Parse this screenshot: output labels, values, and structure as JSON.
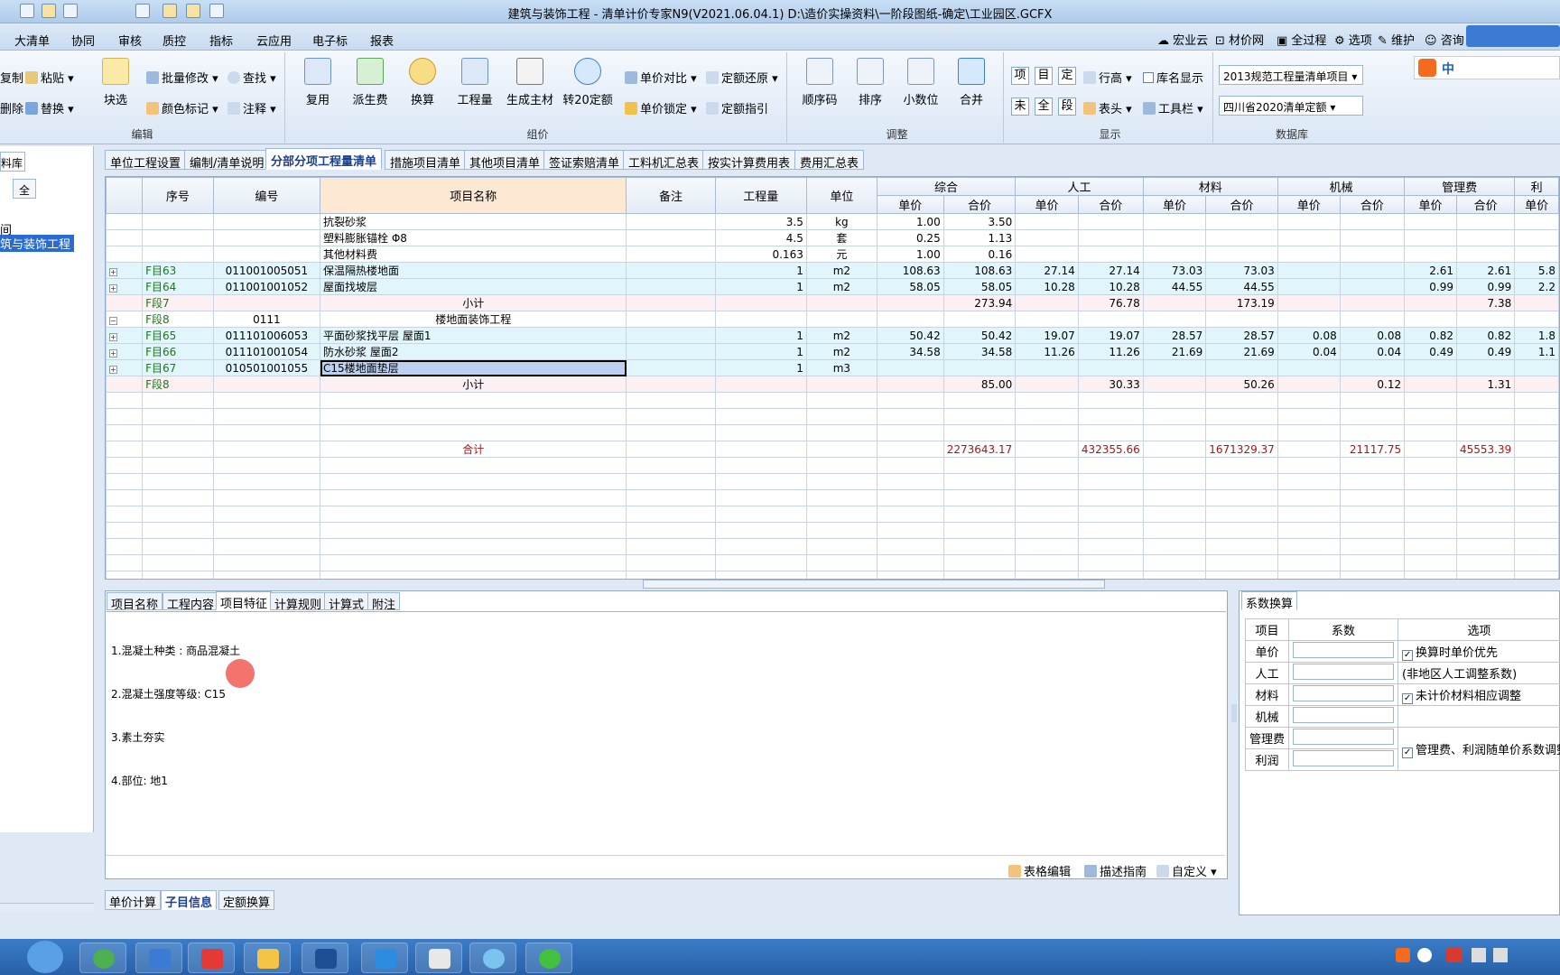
{
  "window": {
    "title": "建筑与装饰工程 - 清单计价专家N9(V2021.06.04.1) D:\\造价实操资料\\一阶段图纸-确定\\工业园区.GCFX"
  },
  "menu": {
    "items": [
      "大清单",
      "协同",
      "审核",
      "质控",
      "指标",
      "云应用",
      "电子标",
      "报表"
    ],
    "right": [
      "宏业云",
      "材价网",
      "全过程",
      "选项",
      "维护",
      "咨询"
    ]
  },
  "ribbon": {
    "edit": {
      "label": "编辑",
      "copy": "复制",
      "paste": "粘贴",
      "delete": "删除",
      "replace": "替换",
      "block_select": "块选",
      "batch_modify": "批量修改",
      "find": "查找",
      "color_mark": "颜色标记",
      "annotate": "注释"
    },
    "pricing": {
      "label": "组价",
      "reuse": "复用",
      "derive_fee": "派生费",
      "convert": "换算",
      "quantity": "工程量",
      "gen_material": "生成主材",
      "to_20_quota": "转20定额",
      "price_compare": "单价对比",
      "quota_restore": "定额还原",
      "price_lock": "单价锁定",
      "quota_guide": "定额指引"
    },
    "adjust": {
      "label": "调整",
      "seq_code": "顺序码",
      "sort": "排序",
      "decimals": "小数位",
      "merge": "合并"
    },
    "display": {
      "label": "显示",
      "v1": "项",
      "v2": "目",
      "v3": "定",
      "v4": "未",
      "v5": "全",
      "v6": "段",
      "row_height": "行高",
      "lib_name": "库名显示",
      "header": "表头",
      "toolbar": "工具栏"
    },
    "database": {
      "label": "数据库",
      "standard": "2013规范工程量清单项目",
      "quota": "四川省2020清单定额"
    }
  },
  "left_panel": {
    "tab": "料库",
    "button": "全",
    "tree": [
      "间",
      "筑与装饰工程"
    ]
  },
  "tabs": [
    "单位工程设置",
    "编制/清单说明",
    "分部分项工程量清单",
    "措施项目清单",
    "其他项目清单",
    "签证索赔清单",
    "工料机汇总表",
    "按实计算费用表",
    "费用汇总表"
  ],
  "grid": {
    "headers": {
      "seq": "序号",
      "code": "编号",
      "name": "项目名称",
      "remark": "备注",
      "qty": "工程量",
      "unit": "单位",
      "groups": [
        "综合",
        "人工",
        "材料",
        "机械",
        "管理费",
        "利"
      ],
      "unit_price": "单价",
      "total": "合价"
    },
    "rows": [
      {
        "type": "white",
        "seq": "",
        "code": "",
        "name": "抗裂砂浆",
        "qty": "3.5",
        "unit": "kg",
        "c": [
          "1.00",
          "3.50",
          "",
          "",
          "",
          "",
          "",
          "",
          "",
          "",
          ""
        ]
      },
      {
        "type": "white",
        "seq": "",
        "code": "",
        "name": "塑料膨胀锚栓 Φ8",
        "qty": "4.5",
        "unit": "套",
        "c": [
          "0.25",
          "1.13",
          "",
          "",
          "",
          "",
          "",
          "",
          "",
          "",
          ""
        ]
      },
      {
        "type": "white",
        "seq": "",
        "code": "",
        "name": "其他材料费",
        "qty": "0.163",
        "unit": "元",
        "c": [
          "1.00",
          "0.16",
          "",
          "",
          "",
          "",
          "",
          "",
          "",
          "",
          ""
        ]
      },
      {
        "type": "blue",
        "seq": "F目63",
        "code": "011001005051",
        "name": "保温隔热楼地面",
        "qty": "1",
        "unit": "m2",
        "c": [
          "108.63",
          "108.63",
          "27.14",
          "27.14",
          "73.03",
          "73.03",
          "",
          "",
          "2.61",
          "2.61",
          "5.8"
        ]
      },
      {
        "type": "blue",
        "seq": "F目64",
        "code": "011001001052",
        "name": "屋面找坡层",
        "qty": "1",
        "unit": "m2",
        "c": [
          "58.05",
          "58.05",
          "10.28",
          "10.28",
          "44.55",
          "44.55",
          "",
          "",
          "0.99",
          "0.99",
          "2.2"
        ]
      },
      {
        "type": "pink",
        "seq": "F段7",
        "code": "",
        "name": "小计",
        "qty": "",
        "unit": "",
        "c": [
          "",
          "273.94",
          "",
          "76.78",
          "",
          "173.19",
          "",
          "",
          "",
          "7.38",
          ""
        ]
      },
      {
        "type": "white",
        "seq": "F段8",
        "code": "0111",
        "name": "楼地面装饰工程",
        "qty": "",
        "unit": "",
        "c": [
          "",
          "",
          "",
          "",
          "",
          "",
          "",
          "",
          "",
          "",
          ""
        ]
      },
      {
        "type": "blue",
        "seq": "F目65",
        "code": "011101006053",
        "name": "平面砂浆找平层 屋面1",
        "qty": "1",
        "unit": "m2",
        "c": [
          "50.42",
          "50.42",
          "19.07",
          "19.07",
          "28.57",
          "28.57",
          "0.08",
          "0.08",
          "0.82",
          "0.82",
          "1.8"
        ]
      },
      {
        "type": "blue",
        "seq": "F目66",
        "code": "011101001054",
        "name": "防水砂浆 屋面2",
        "qty": "1",
        "unit": "m2",
        "c": [
          "34.58",
          "34.58",
          "11.26",
          "11.26",
          "21.69",
          "21.69",
          "0.04",
          "0.04",
          "0.49",
          "0.49",
          "1.1"
        ]
      },
      {
        "type": "sel",
        "seq": "F目67",
        "code": "010501001055",
        "name": "C15楼地面垫层",
        "qty": "1",
        "unit": "m3",
        "c": [
          "",
          "",
          "",
          "",
          "",
          "",
          "",
          "",
          "",
          "",
          ""
        ]
      },
      {
        "type": "pink",
        "seq": "F段8",
        "code": "",
        "name": "小计",
        "qty": "",
        "unit": "",
        "c": [
          "",
          "85.00",
          "",
          "30.33",
          "",
          "50.26",
          "",
          "0.12",
          "",
          "1.31",
          ""
        ]
      }
    ],
    "total": {
      "label": "合计",
      "c": [
        "",
        "2273643.17",
        "",
        "432355.66",
        "",
        "1671329.37",
        "",
        "21117.75",
        "",
        "45553.39",
        ""
      ]
    }
  },
  "bottom_tabs": [
    "项目名称",
    "工程内容",
    "项目特征",
    "计算规则",
    "计算式",
    "附注"
  ],
  "features": {
    "lines": [
      "1.混凝土种类 : 商品混凝土",
      "2.混凝土强度等级: C15",
      "3.素土夯实",
      "4.部位: 地1"
    ]
  },
  "bottom_tools": {
    "table_edit": "表格编辑",
    "desc_guide": "描述指南",
    "customize": "自定义"
  },
  "lower_tabs": [
    "单价计算",
    "子目信息",
    "定额换算"
  ],
  "coefficient": {
    "tab": "系数换算",
    "headers": [
      "项目",
      "系数",
      "选项"
    ],
    "rows": [
      "单价",
      "人工",
      "材料",
      "机械",
      "管理费",
      "利润"
    ],
    "opt_price_first": "换算时单价优先",
    "opt_nonlocal": "(非地区人工调整系数)",
    "opt_unpriced": "未计价材料相应调整",
    "opt_mgmt": "管理费、利润随单价系数调整"
  },
  "input_method": {
    "lang": "中"
  },
  "colors": {
    "accent": "#1c3f8c",
    "row_blue": "#e1f6fa",
    "row_pink": "#fdf0f3",
    "total_red": "#a01818"
  }
}
